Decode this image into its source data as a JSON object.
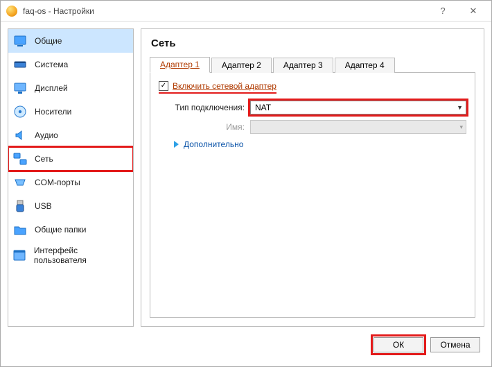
{
  "window": {
    "title": "faq-os - Настройки",
    "help_tooltip": "?",
    "close_tooltip": "✕"
  },
  "sidebar": {
    "items": [
      {
        "label": "Общие",
        "icon": "general-icon"
      },
      {
        "label": "Система",
        "icon": "system-icon"
      },
      {
        "label": "Дисплей",
        "icon": "display-icon"
      },
      {
        "label": "Носители",
        "icon": "storage-icon"
      },
      {
        "label": "Аудио",
        "icon": "audio-icon"
      },
      {
        "label": "Сеть",
        "icon": "network-icon"
      },
      {
        "label": "COM-порты",
        "icon": "serial-icon"
      },
      {
        "label": "USB",
        "icon": "usb-icon"
      },
      {
        "label": "Общие папки",
        "icon": "shared-folder-icon"
      },
      {
        "label": "Интерфейс пользователя",
        "icon": "ui-icon"
      }
    ],
    "selected_index": 5,
    "highlighted_index": 5
  },
  "content": {
    "title": "Сеть",
    "tabs": [
      "Адаптер 1",
      "Адаптер 2",
      "Адаптер 3",
      "Адаптер 4"
    ],
    "active_tab": 0,
    "enable_adapter": {
      "label": "Включить сетевой адаптер",
      "checked": true
    },
    "attach_type": {
      "label": "Тип подключения:",
      "value": "NAT"
    },
    "name_field": {
      "label": "Имя:",
      "value": "",
      "disabled": true
    },
    "advanced_label": "Дополнительно"
  },
  "footer": {
    "ok_label": "ОК",
    "cancel_label": "Отмена"
  }
}
